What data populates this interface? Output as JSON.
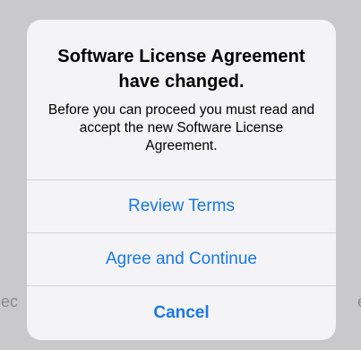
{
  "background": {
    "left_text": "Rec",
    "right_text": "er"
  },
  "alert": {
    "title": "Software License Agreement have changed.",
    "message": "Before you can proceed you must read and accept the new Software License Agreement.",
    "buttons": {
      "review": "Review Terms",
      "agree": "Agree and Continue",
      "cancel": "Cancel"
    }
  },
  "colors": {
    "accent": "#1a78e6",
    "alert_background": "#f4f4f6",
    "backdrop": "#c9c9cb",
    "separator": "#d4d4d7"
  }
}
